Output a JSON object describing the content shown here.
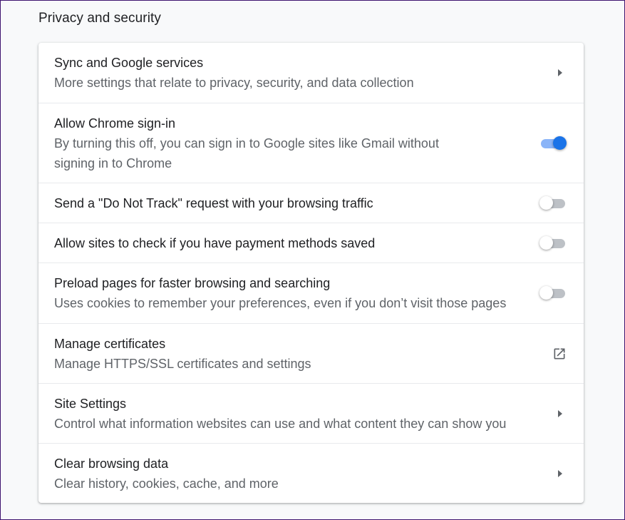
{
  "section": {
    "title": "Privacy and security"
  },
  "rows": [
    {
      "label": "Sync and Google services",
      "sub": "More settings that relate to privacy, security, and data collection",
      "control": "chevron-right-icon"
    },
    {
      "label": "Allow Chrome sign-in",
      "sub": "By turning this off, you can sign in to Google sites like Gmail without signing in to Chrome",
      "control": "toggle",
      "checked": true
    },
    {
      "label": "Send a \"Do Not Track\" request with your browsing traffic",
      "control": "toggle",
      "checked": false
    },
    {
      "label": "Allow sites to check if you have payment methods saved",
      "control": "toggle",
      "checked": false
    },
    {
      "label": "Preload pages for faster browsing and searching",
      "sub": "Uses cookies to remember your preferences, even if you don’t visit those pages",
      "control": "toggle",
      "checked": false
    },
    {
      "label": "Manage certificates",
      "sub": "Manage HTTPS/SSL certificates and settings",
      "control": "open-in-new-icon"
    },
    {
      "label": "Site Settings",
      "sub": "Control what information websites can use and what content they can show you",
      "control": "chevron-right-icon"
    },
    {
      "label": "Clear browsing data",
      "sub": "Clear history, cookies, cache, and more",
      "control": "chevron-right-icon"
    }
  ],
  "colors": {
    "accent": "#1a73e8",
    "accent_track": "#8ab4f8",
    "toggle_off_track": "#bdc1c6",
    "text_primary": "#202124",
    "text_secondary": "#5f6368"
  }
}
